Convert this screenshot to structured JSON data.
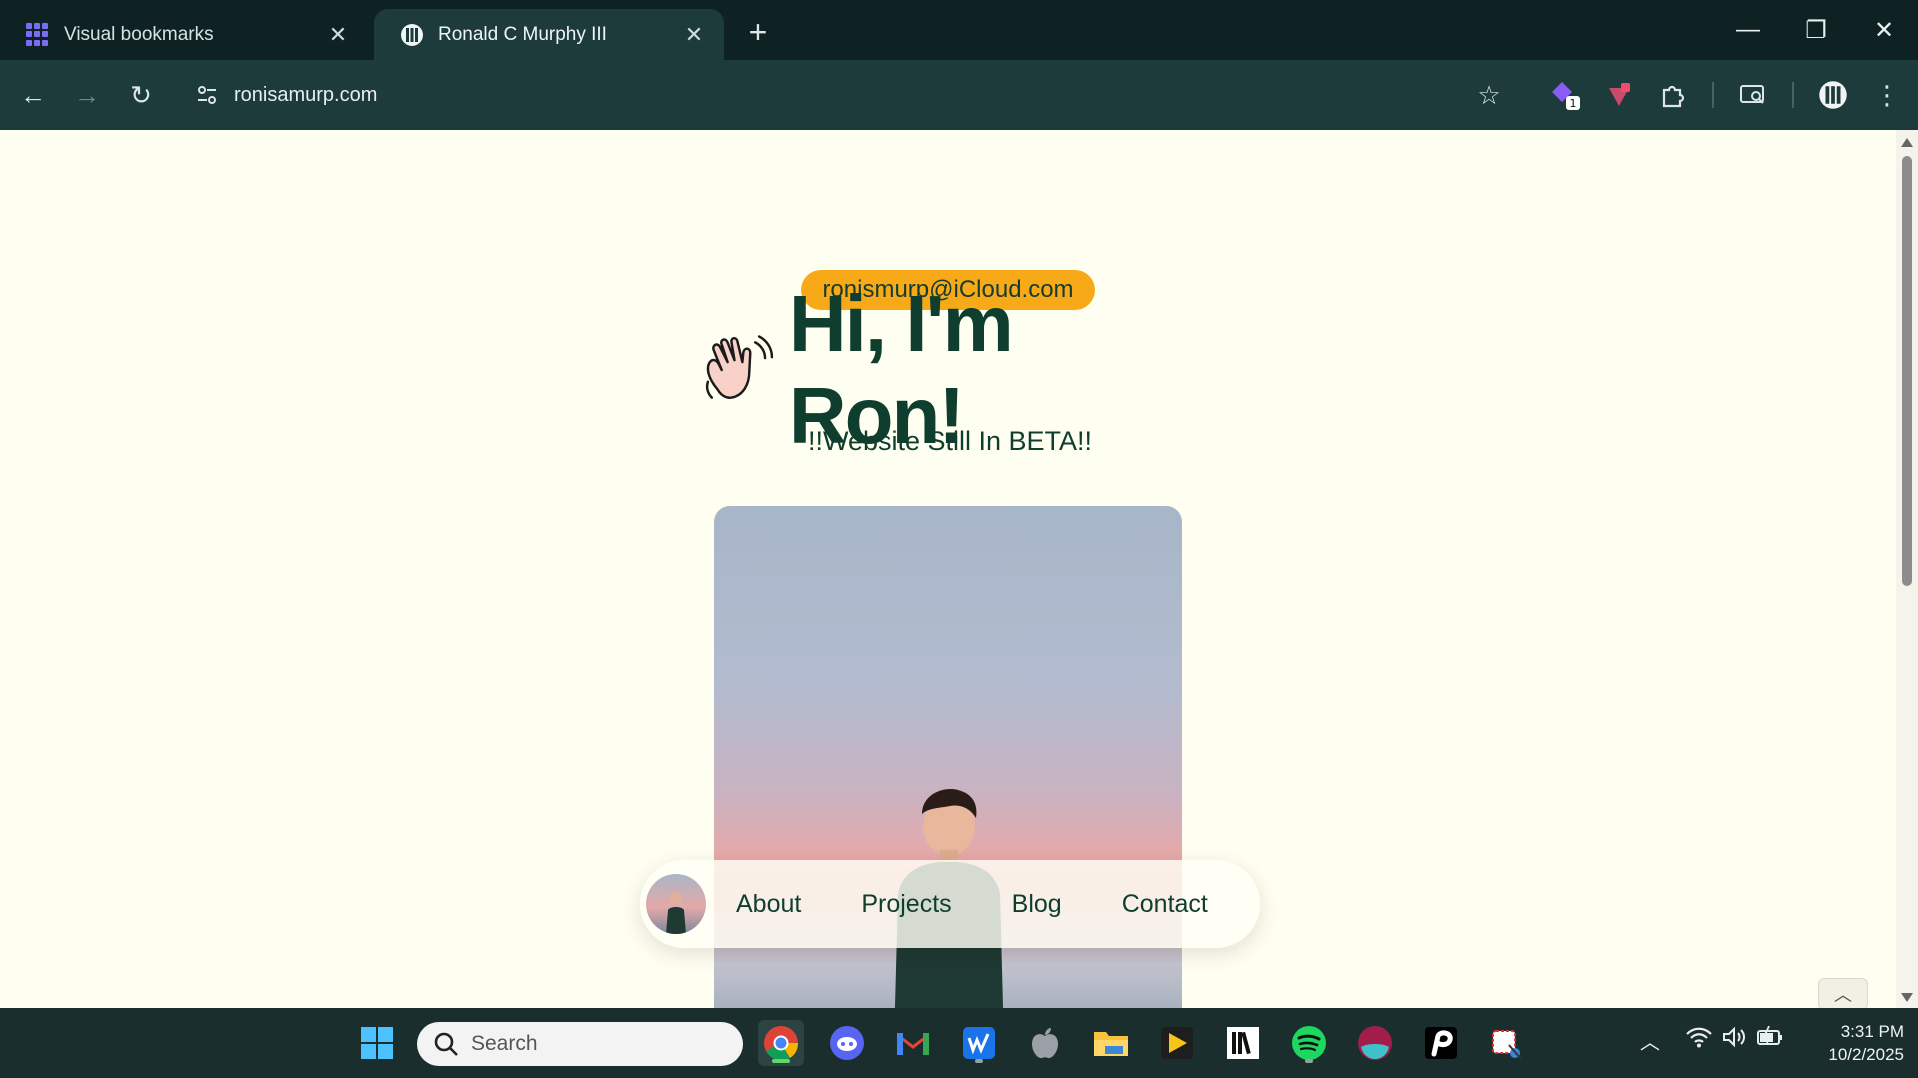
{
  "browser": {
    "tabs": [
      {
        "title": "Visual bookmarks",
        "active": false
      },
      {
        "title": "Ronald C Murphy III",
        "active": true
      }
    ],
    "url": "ronisamurp.com",
    "extension_badge": "1"
  },
  "page": {
    "email": "ronismurp@iCloud.com",
    "hero_title": "Hi, I'm Ron!",
    "subtitle": "!!Website Still In BETA!!",
    "nav": {
      "links": [
        "About",
        "Projects",
        "Blog",
        "Contact"
      ]
    }
  },
  "taskbar": {
    "search_placeholder": "Search",
    "time": "3:31 PM",
    "date": "10/2/2025"
  },
  "colors": {
    "page_bg": "#fffff1",
    "accent_pill": "#f7a918",
    "heading": "#0f3d2e",
    "chrome_bg": "#1d3b3b"
  }
}
